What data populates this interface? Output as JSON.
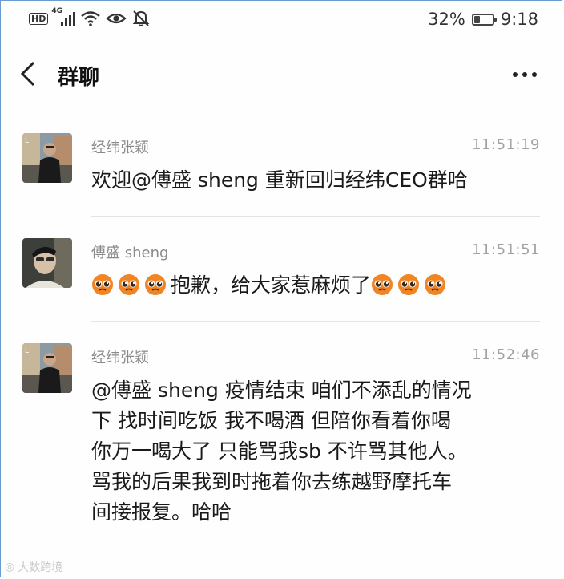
{
  "status_bar": {
    "network": "4G",
    "hd_label": "HD",
    "battery_percent": "32%",
    "battery_level": 0.32,
    "time": "9:18"
  },
  "header": {
    "title": "群聊"
  },
  "messages": [
    {
      "sender": "经纬张颖",
      "time": "11:51:19",
      "text": "欢迎@傅盛 sheng 重新回归经纬CEO群哈"
    },
    {
      "sender": "傅盛 sheng",
      "time": "11:51:51",
      "text": "抱歉，给大家惹麻烦了",
      "emoji": "pleading-face-icon"
    },
    {
      "sender": "经纬张颖",
      "time": "11:52:46",
      "lines": [
        "@傅盛 sheng 疫情结束 咱们不添乱的情况",
        "下 找时间吃饭 我不喝酒 但陪你看着你喝",
        "你万一喝大了 只能骂我sb 不许骂其他人。",
        "骂我的后果我到时拖着你去练越野摩托车",
        "间接报复。哈哈"
      ]
    }
  ],
  "watermark": "大数跨境"
}
